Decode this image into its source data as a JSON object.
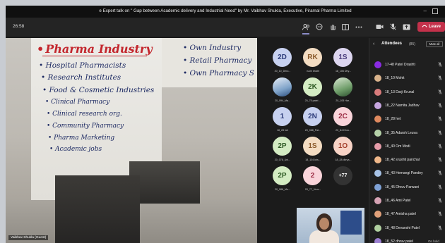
{
  "window": {
    "title": "e Expert talk on \" Gap between Academic delivery and Industrial Need\" by Mr. Vaibhav Shukla, Executive, Piramal Pharma Limited"
  },
  "toolbar": {
    "timer": "26:58",
    "leave_label": "Leave"
  },
  "presentation": {
    "heading": "Pharma Industry",
    "left_items": [
      "Hospital Pharmacists",
      "Research Institutes",
      "Food & Cosmetic Industries",
      "Clinical Pharmacy",
      "Clinical research org.",
      "Community Pharmacy",
      "Pharma Marketing",
      "Academic jobs"
    ],
    "right_items": [
      "Own Industry",
      "Retail Pharmacy",
      "Own Pharmacy S"
    ],
    "presenter": "Vaibhav Shukla (Guest)"
  },
  "participants": [
    {
      "initials": "2D",
      "label": "20_10_Dhru...",
      "style": "av-blue"
    },
    {
      "initials": "RK",
      "label": "ruchi khatri",
      "style": "av-tan"
    },
    {
      "initials": "1S",
      "label": "18_106 Dhy...",
      "style": "av-lav"
    },
    {
      "initials": "",
      "label": "20_094_Ma...",
      "style": "av-photo"
    },
    {
      "initials": "2K",
      "label": "20_75 patel ...",
      "style": "av-green"
    },
    {
      "initials": "",
      "label": "20_105 Har...",
      "style": "av-photo2"
    },
    {
      "initials": "1",
      "label": "18_28 het",
      "style": "av-blue"
    },
    {
      "initials": "2N",
      "label": "20_088_Pat...",
      "style": "av-blue"
    },
    {
      "initials": "2C",
      "label": "20_84 Dhru...",
      "style": "av-pink"
    },
    {
      "initials": "2P",
      "label": "20_078_Uni...",
      "style": "av-green"
    },
    {
      "initials": "1S",
      "label": "18_104 kris...",
      "style": "av-tan"
    },
    {
      "initials": "1O",
      "label": "18_28 dhrya...",
      "style": "av-peach"
    },
    {
      "initials": "2P",
      "label": "20_086_Mu...",
      "style": "av-green"
    },
    {
      "initials": "2",
      "label": "20_77_Vrus...",
      "style": "av-pink"
    },
    {
      "initials": "+77",
      "label": "",
      "style": "av-more"
    }
  ],
  "attendees_panel": {
    "title": "Attendees",
    "count": "(85)",
    "mute_all": "Mute all",
    "list": [
      {
        "name": "17-48 Patel Drashti",
        "color": "#8a2be2",
        "status": ""
      },
      {
        "name": "18_10 Mohit",
        "color": "#d9b38c",
        "status": ""
      },
      {
        "name": "18_13 Darji Krunal",
        "color": "#d97c7c",
        "status": ""
      },
      {
        "name": "18_22 Namita Jadhav",
        "color": "#c7a6e0",
        "status": ""
      },
      {
        "name": "18_28 het",
        "color": "#e08a5f",
        "status": ""
      },
      {
        "name": "18_35 Adarsh Leuva",
        "color": "#b5d1a8",
        "status": ""
      },
      {
        "name": "18_40 Om Modi",
        "color": "#e59ca8",
        "status": ""
      },
      {
        "name": "18_42 srushti panchal",
        "color": "#f0b88a",
        "status": ""
      },
      {
        "name": "18_43 Hemangi Pandey",
        "color": "#a8c3e6",
        "status": ""
      },
      {
        "name": "18_45 Dhruv Parwani",
        "color": "#7fa2d6",
        "status": ""
      },
      {
        "name": "18_46 Ami Patel",
        "color": "#d6a3b5",
        "status": ""
      },
      {
        "name": "18_47 Amisha patel",
        "color": "#e0a07a",
        "status": ""
      },
      {
        "name": "18_48 Devanshi Patel",
        "color": "#b0d0a0",
        "status": ""
      },
      {
        "name": "18_52 dhruv patel",
        "color": "#9b7fd1",
        "status": "On hold"
      }
    ]
  },
  "colors": {
    "leave": "#c4314b",
    "heading_red": "#c3262d",
    "ink_blue": "#1d2a63"
  }
}
